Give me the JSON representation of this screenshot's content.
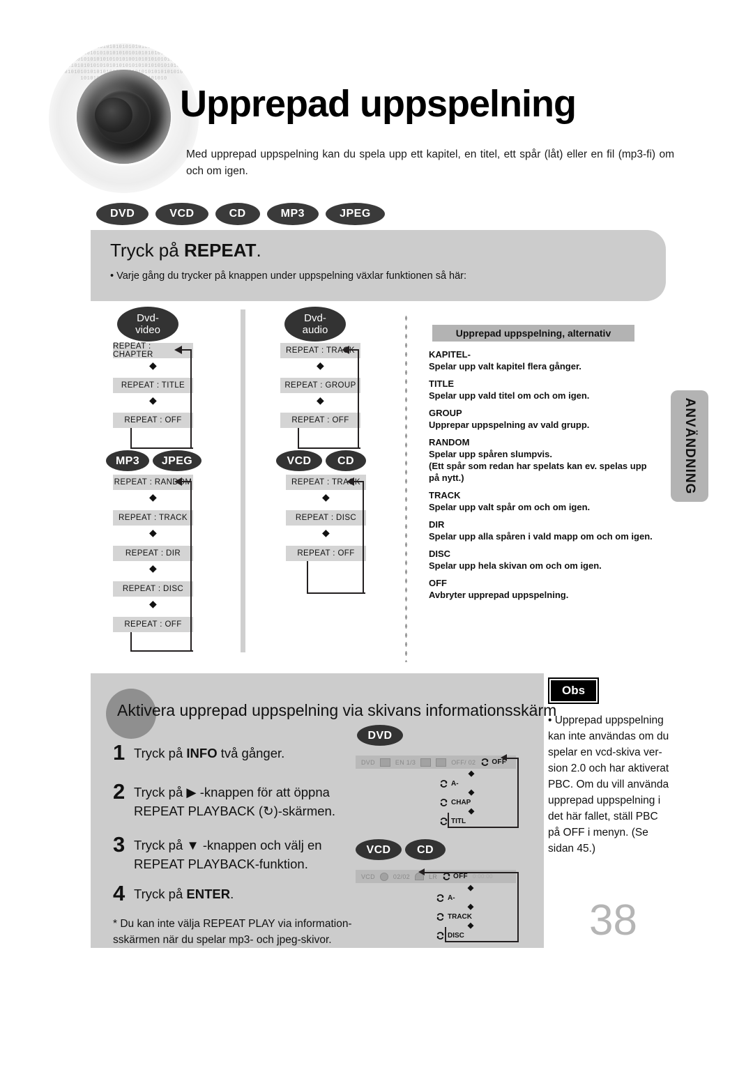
{
  "header": {
    "title": "Upprepad uppspelning",
    "intro": "Med upprepad uppspelning kan du spela upp ett kapitel, en titel, ett spår (låt) eller en fil (mp3-fi) om och om igen.",
    "badges": [
      "DVD",
      "VCD",
      "CD",
      "MP3",
      "JPEG"
    ]
  },
  "panel": {
    "title_prefix": "Tryck på ",
    "title_strong": "REPEAT",
    "title_suffix": ".",
    "bullet": "• Varje gång du trycker på knappen under uppspelning växlar funktionen så här:"
  },
  "flows": [
    {
      "label": "Dvd-\nvideo",
      "label_line1": "Dvd-",
      "label_line2": "video",
      "steps": [
        "REPEAT : CHAPTER",
        "REPEAT : TITLE",
        "REPEAT : OFF"
      ]
    },
    {
      "label_line1": "Dvd-",
      "label_line2": "audio",
      "steps": [
        "REPEAT : TRACK",
        "REPEAT : GROUP",
        "REPEAT : OFF"
      ]
    },
    {
      "pills": [
        "MP3",
        "JPEG"
      ],
      "steps": [
        "REPEAT : RANDOM",
        "REPEAT : TRACK",
        "REPEAT : DIR",
        "REPEAT : DISC",
        "REPEAT : OFF"
      ]
    },
    {
      "pills": [
        "VCD",
        "CD"
      ],
      "steps": [
        "REPEAT : TRACK",
        "REPEAT : DISC",
        "REPEAT : OFF"
      ]
    }
  ],
  "alternatives": {
    "heading": "Upprepad uppspelning, alternativ",
    "items": [
      {
        "term": "KAPITEL-",
        "desc": "Spelar upp valt kapitel flera gånger."
      },
      {
        "term": "TITLE",
        "desc": "Spelar upp vald titel om och om igen."
      },
      {
        "term": "GROUP",
        "desc": "Upprepar uppspelning av vald grupp."
      },
      {
        "term": "RANDOM",
        "desc": "Spelar upp spåren slumpvis.\n(Ett spår som redan har spelats kan ev. spelas upp på nytt.)"
      },
      {
        "term": "TRACK",
        "desc": "Spelar upp valt spår om och om igen."
      },
      {
        "term": "DIR",
        "desc": "Spelar upp alla spåren i vald mapp om och om igen."
      },
      {
        "term": "DISC",
        "desc": "Spelar upp hela skivan om och om igen."
      },
      {
        "term": "OFF",
        "desc": "Avbryter upprepad uppspelning."
      }
    ]
  },
  "sidetab": {
    "label": "ANVÄNDNING"
  },
  "bottom": {
    "heading": "Aktivera upprepad uppspelning via skivans informationsskärm",
    "steps": [
      {
        "num": "1",
        "text_a": "Tryck på ",
        "bold": "INFO",
        "text_b": " två gånger.",
        "line2": ""
      },
      {
        "num": "2",
        "text_a": "Tryck på ▶ -knappen för att öppna",
        "line2": "REPEAT PLAYBACK (↻)-skärmen."
      },
      {
        "num": "3",
        "text_a": "Tryck på ▼ -knappen och välj en",
        "line2": "REPEAT PLAYBACK-funktion."
      },
      {
        "num": "4",
        "text_a": "Tryck på ",
        "bold": "ENTER",
        "text_b": ".",
        "line2": ""
      }
    ],
    "note": "* Du kan inte välja REPEAT PLAY via information-\n   sskärmen när du spelar mp3- och jpeg-skivor."
  },
  "osd_dvd": {
    "pill": "DVD",
    "bar": [
      "DVD",
      "EN 1/3",
      "OFF/ 02"
    ],
    "selected": "OFF",
    "cycle": [
      "A-",
      "CHAP",
      "TITL"
    ]
  },
  "osd_vcd": {
    "pills": [
      "VCD",
      "CD"
    ],
    "bar": [
      "VCD",
      "02/02",
      "LR"
    ],
    "selected": "OFF",
    "time": "0:00:00",
    "cycle": [
      "A-",
      "TRACK",
      "DISC"
    ]
  },
  "obs": {
    "label": "Obs",
    "text": "• Upprepad uppspelning\n  kan inte användas om du\n  spelar en vcd-skiva ver-\n  sion 2.0 och har aktiverat\n  PBC. Om du vill använda\n  upprepad uppspelning i\n  det här fallet, ställ PBC\n  på OFF i menyn. (Se\n  sidan 45.)"
  },
  "page_number": "38",
  "colors": {
    "panel_gray": "#cccccc",
    "box_gray": "#d4d4d4",
    "pill_dark": "#333333",
    "accent_black": "#231f20",
    "page_number_gray": "#b5b5b5"
  }
}
